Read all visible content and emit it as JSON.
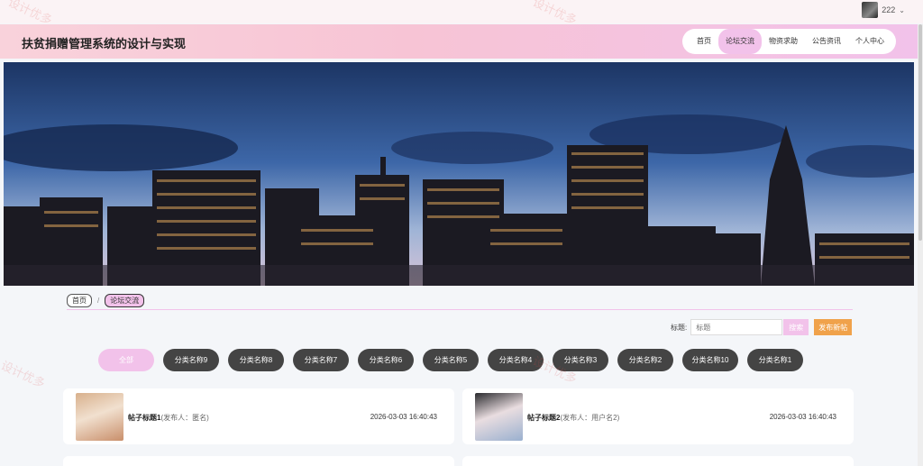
{
  "user": {
    "name": "222"
  },
  "site": {
    "title": "扶贫捐赠管理系统的设计与实现"
  },
  "nav": {
    "items": [
      "首页",
      "论坛交流",
      "物资求助",
      "公告资讯",
      "个人中心"
    ]
  },
  "breadcrumb": {
    "home": "首页",
    "current": "论坛交流"
  },
  "search": {
    "label": "标题:",
    "placeholder": "标题",
    "button": "搜索",
    "publish": "发布新帖"
  },
  "categories": [
    "全部",
    "分类名称9",
    "分类名称8",
    "分类名称7",
    "分类名称6",
    "分类名称5",
    "分类名称4",
    "分类名称3",
    "分类名称2",
    "分类名称10",
    "分类名称1"
  ],
  "posts": [
    {
      "title": "帖子标题1",
      "author": "(发布人：匿名)",
      "time": "2026-03-03 16:40:43"
    },
    {
      "title": "帖子标题2",
      "author": "(发布人：用户名2)",
      "time": "2026-03-03 16:40:43"
    }
  ],
  "watermark": "设计优多",
  "colors": {
    "accent": "#f2c2ea",
    "publish": "#f0a24b",
    "category": "#444444"
  }
}
